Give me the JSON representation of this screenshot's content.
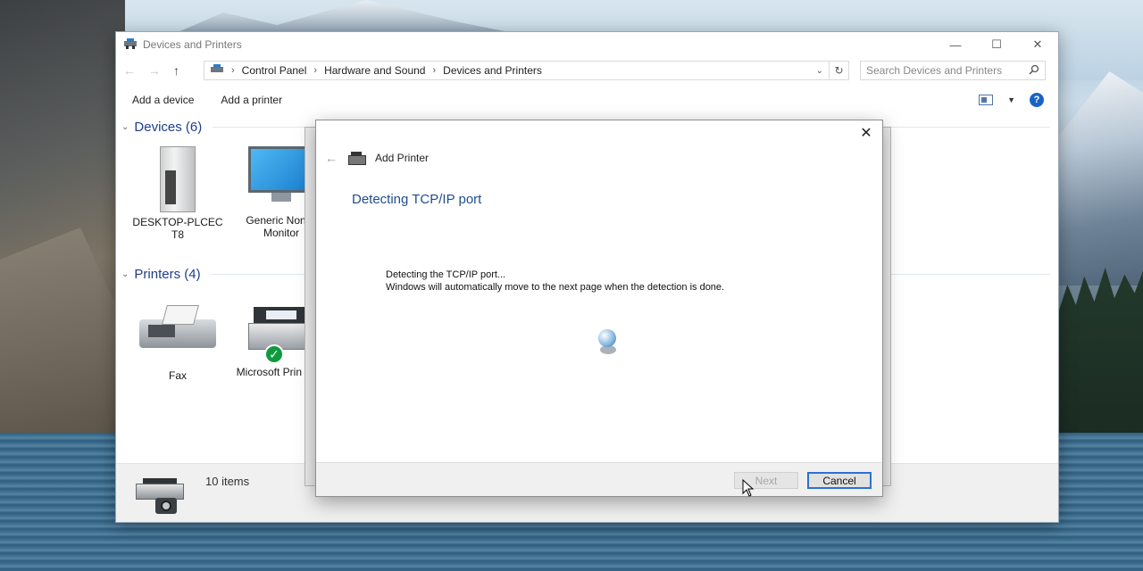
{
  "explorer": {
    "title": "Devices and Printers",
    "breadcrumb": [
      "Control Panel",
      "Hardware and Sound",
      "Devices and Printers"
    ],
    "search_placeholder": "Search Devices and Printers",
    "commands": {
      "add_device": "Add a device",
      "add_printer": "Add a printer"
    },
    "devices_group": "Devices (6)",
    "printers_group": "Printers (4)",
    "devices": [
      {
        "label": "DESKTOP-PLCEC T8"
      },
      {
        "label": "Generic Non-P Monitor"
      }
    ],
    "printers": [
      {
        "label": "Fax"
      },
      {
        "label": "Microsoft Prin PDF"
      }
    ],
    "status_count": "10 items"
  },
  "dialog": {
    "title": "Add Printer",
    "heading": "Detecting TCP/IP port",
    "message_line1": "Detecting the TCP/IP port...",
    "message_line2": "Windows will automatically move to the next page when the detection is done.",
    "next_label": "Next",
    "cancel_label": "Cancel"
  },
  "icons": {
    "help": "?",
    "close": "✕"
  }
}
